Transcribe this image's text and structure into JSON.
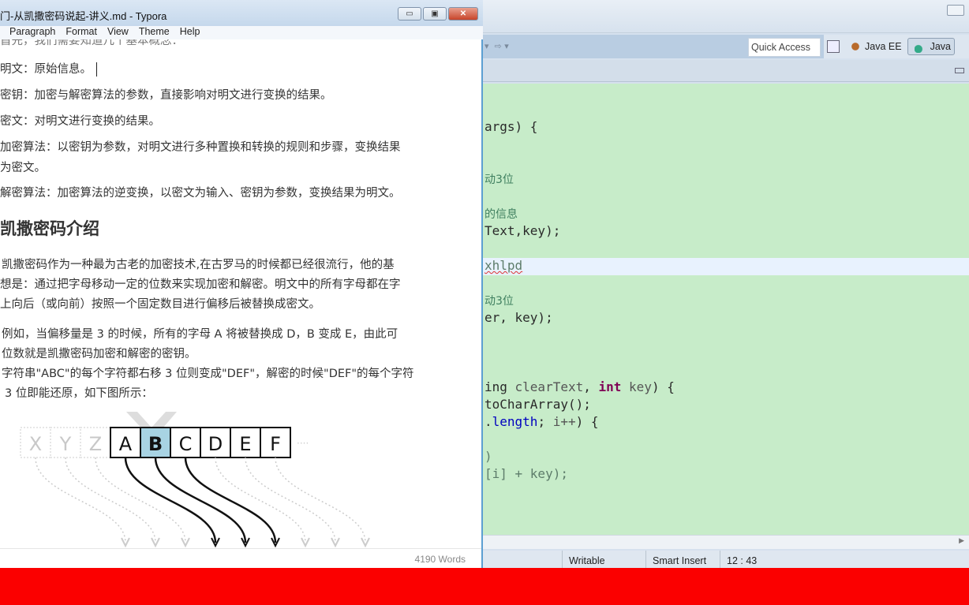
{
  "typora": {
    "title": "门-从凯撒密码说起-讲义.md - Typora",
    "window_buttons": {
      "minimize": "▭",
      "maximize": "▣",
      "close": "✕"
    },
    "menu": [
      "Paragraph",
      "Format",
      "View",
      "Theme",
      "Help"
    ],
    "partial_top_line": "首先，我们需要知道几个基本概念：",
    "definitions": [
      "明文：原始信息。",
      "密钥：加密与解密算法的参数，直接影响对明文进行变换的结果。",
      "密文：对明文进行变换的结果。",
      "加密算法：以密钥为参数，对明文进行多种置换和转换的规则和步骤，变换结果",
      "为密文。",
      "解密算法：加密算法的逆变换，以密文为输入、密钥为参数，变换结果为明文。"
    ],
    "heading": "凯撒密码介绍",
    "paragraphs": [
      "凯撒密码作为一种最为古老的加密技术,在古罗马的时候都已经很流行，他的基",
      "想是：通过把字母移动一定的位数来实现加密和解密。明文中的所有字母都在字",
      "上向后（或向前）按照一个固定数目进行偏移后被替换成密文。",
      "例如，当偏移量是 3 的时候，所有的字母 A 将被替换成 D，B 变成 E，由此可",
      "位数就是凯撒密码加密和解密的密钥。",
      "字符串\"ABC\"的每个字符都右移 3 位则变成\"DEF\"，解密的时候\"DEF\"的每个字符",
      "3 位即能还原，如下图所示："
    ],
    "diagram": {
      "faded_letters": [
        "X",
        "Y",
        "Z"
      ],
      "letters": [
        "A",
        "B",
        "C",
        "D",
        "E",
        "F"
      ],
      "ellipsis": "····",
      "highlight_color": "#a8d3e3"
    },
    "word_count": "4190 Words"
  },
  "eclipse": {
    "quick_access": "Quick Access",
    "perspectives": [
      {
        "label": "Java EE",
        "active": false
      },
      {
        "label": "Java",
        "active": true
      }
    ],
    "code_lines": [
      [],
      [],
      [
        {
          "t": "args) {"
        }
      ],
      [],
      [],
      [
        {
          "t": "动3位",
          "c": "cmt"
        }
      ],
      [],
      [
        {
          "t": "的信息",
          "c": "cmt"
        }
      ],
      [
        {
          "t": "Text,key);"
        }
      ],
      [],
      [
        {
          "t": "xhlpd",
          "c": "dim sq"
        }
      ],
      [],
      [
        {
          "t": "动3位",
          "c": "cmt"
        }
      ],
      [
        {
          "t": "er, key);"
        }
      ],
      [],
      [],
      [],
      [
        {
          "t": "ing "
        },
        {
          "t": "clearText",
          "c": "var"
        },
        {
          "t": ", "
        },
        {
          "t": "int",
          "c": "kw"
        },
        {
          "t": " "
        },
        {
          "t": "key",
          "c": "var"
        },
        {
          "t": ") {"
        }
      ],
      [
        {
          "t": "toCharArray();"
        }
      ],
      [
        {
          "t": ".",
          "c": ""
        },
        {
          "t": "length",
          "c": "fld"
        },
        {
          "t": "; "
        },
        {
          "t": "i++",
          "c": "var"
        },
        {
          "t": ") {"
        }
      ],
      [],
      [
        {
          "t": ")",
          "c": "dim"
        }
      ],
      [
        {
          "t": "[i] + key);",
          "c": "dim"
        }
      ]
    ],
    "status": {
      "writable": "Writable",
      "insert_mode": "Smart Insert",
      "position": "12 : 43"
    }
  },
  "colors": {
    "editor_bg": "#c7ecc9",
    "current_line": "#e8f2fe",
    "keyword": "#7f0055",
    "bottom_bar": "#fb0000"
  }
}
